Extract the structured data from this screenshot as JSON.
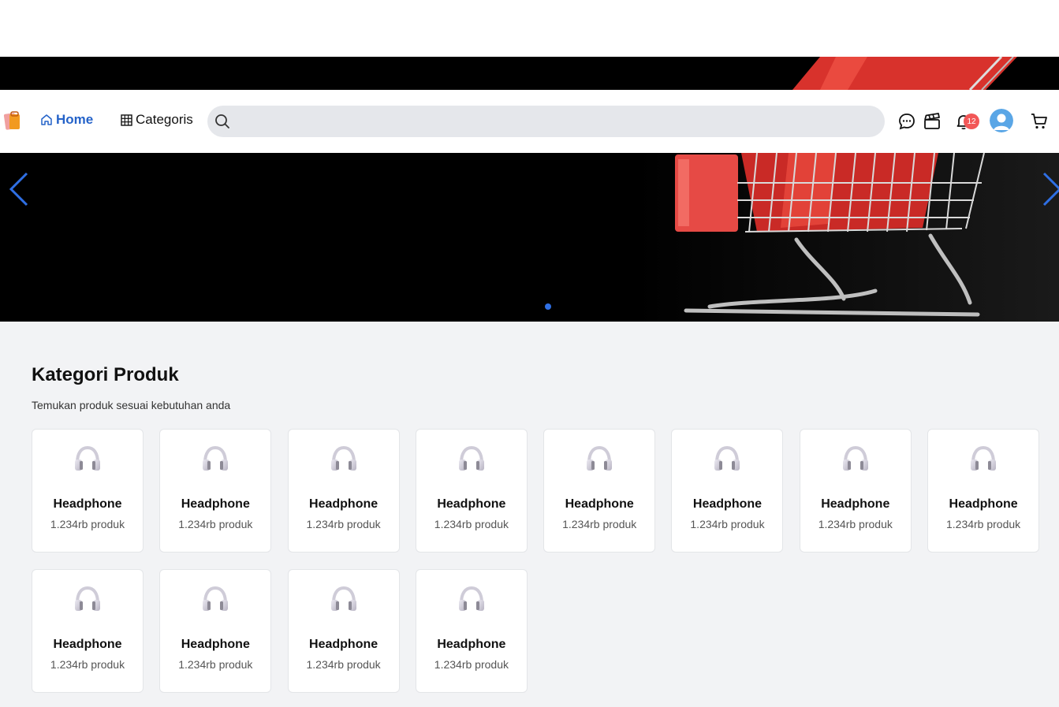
{
  "nav": {
    "home_label": "Home",
    "categories_label": "Categoris",
    "search_placeholder": "",
    "notification_count": "12",
    "accent_color": "#2563c9",
    "badge_color": "#f25757"
  },
  "section": {
    "title": "Kategori Produk",
    "subtitle": "Temukan produk sesuai kebutuhan anda"
  },
  "categories": [
    {
      "name": "Headphone",
      "count": "1.234rb produk",
      "icon": "headphone-icon"
    },
    {
      "name": "Headphone",
      "count": "1.234rb produk",
      "icon": "headphone-icon"
    },
    {
      "name": "Headphone",
      "count": "1.234rb produk",
      "icon": "headphone-icon"
    },
    {
      "name": "Headphone",
      "count": "1.234rb produk",
      "icon": "headphone-icon"
    },
    {
      "name": "Headphone",
      "count": "1.234rb produk",
      "icon": "headphone-icon"
    },
    {
      "name": "Headphone",
      "count": "1.234rb produk",
      "icon": "headphone-icon"
    },
    {
      "name": "Headphone",
      "count": "1.234rb produk",
      "icon": "headphone-icon"
    },
    {
      "name": "Headphone",
      "count": "1.234rb produk",
      "icon": "headphone-icon"
    },
    {
      "name": "Headphone",
      "count": "1.234rb produk",
      "icon": "headphone-icon"
    },
    {
      "name": "Headphone",
      "count": "1.234rb produk",
      "icon": "headphone-icon"
    },
    {
      "name": "Headphone",
      "count": "1.234rb produk",
      "icon": "headphone-icon"
    },
    {
      "name": "Headphone",
      "count": "1.234rb produk",
      "icon": "headphone-icon"
    }
  ]
}
